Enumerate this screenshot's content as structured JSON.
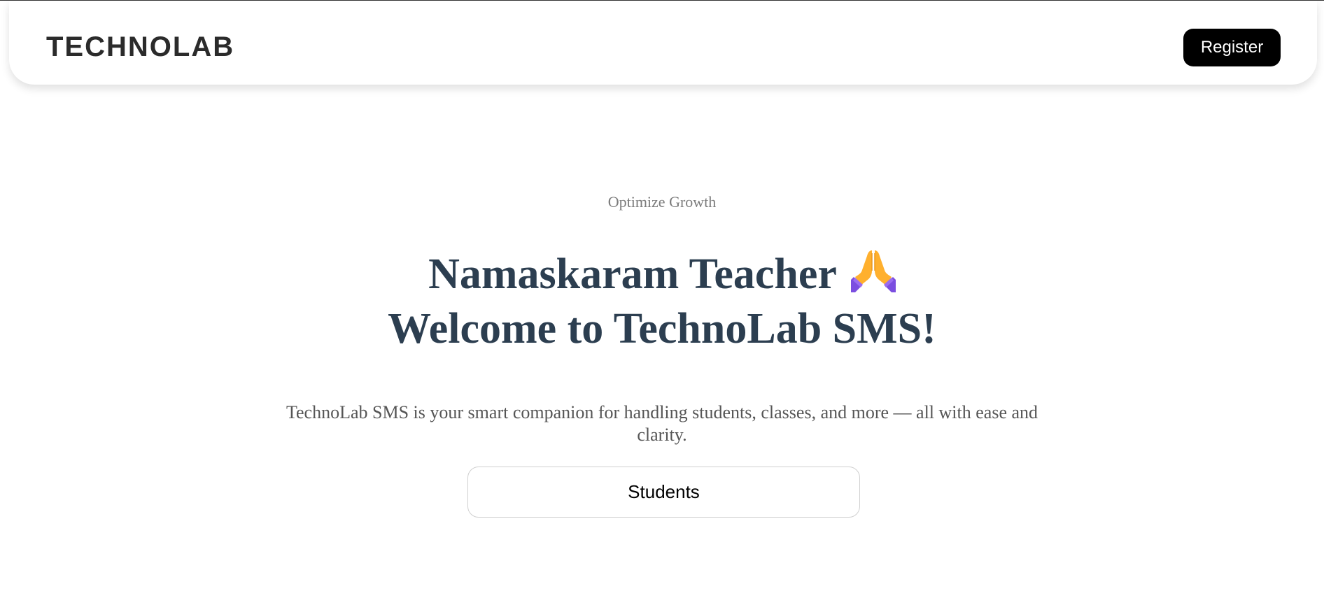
{
  "navbar": {
    "brand": "TECHNOLAB",
    "register_label": "Register"
  },
  "hero": {
    "tagline": "Optimize Growth",
    "headline_line1": "Namaskaram Teacher",
    "headline_line2": "Welcome to TechnoLab SMS!",
    "headline_icon": "folded-hands-icon",
    "description": "TechnoLab SMS is your smart companion for handling students, classes, and more — all with ease and clarity.",
    "students_label": "Students"
  },
  "colors": {
    "heading": "#2c3e50",
    "brand": "#2b2b2b",
    "tagline": "#7b7b7b",
    "body_text": "#555555",
    "register_bg": "#000000",
    "register_text": "#ffffff",
    "button_border": "#d0d0d0"
  }
}
